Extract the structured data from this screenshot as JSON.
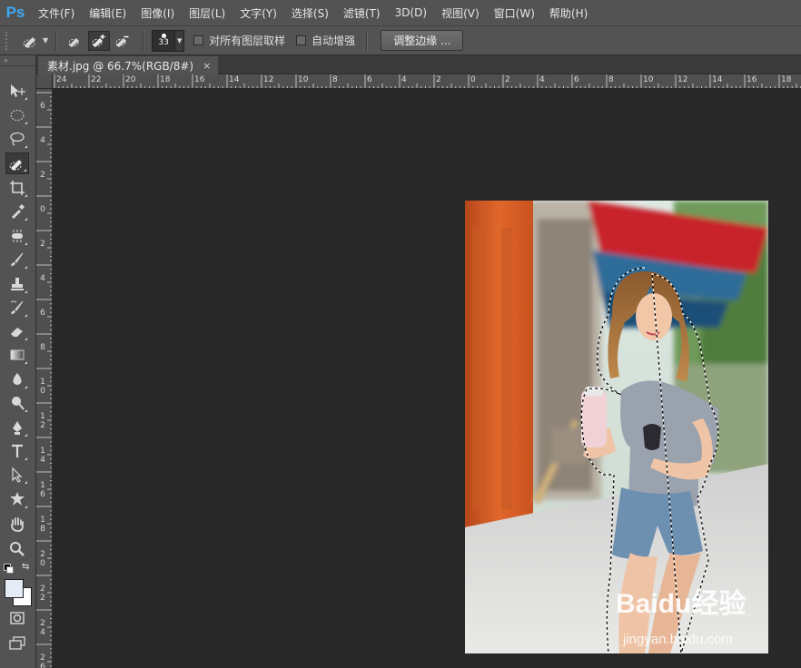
{
  "app": {
    "logo_text": "Ps",
    "accent": "#3fa9f5"
  },
  "menu": [
    "文件(F)",
    "编辑(E)",
    "图像(I)",
    "图层(L)",
    "文字(Y)",
    "选择(S)",
    "滤镜(T)",
    "3D(D)",
    "视图(V)",
    "窗口(W)",
    "帮助(H)"
  ],
  "options": {
    "brush_size": "33",
    "sample_all_layers_label": "对所有图层取样",
    "sample_all_layers_checked": false,
    "auto_enhance_label": "自动增强",
    "auto_enhance_checked": false,
    "refine_edge_label": "调整边缘 ...",
    "active_mode": "add-to-selection"
  },
  "document": {
    "tab_title": "素材.jpg @ 66.7%(RGB/8#)",
    "close_glyph": "×"
  },
  "rulers": {
    "horizontal": [
      "24",
      "22",
      "20",
      "18",
      "16",
      "14",
      "12",
      "10",
      "8",
      "6",
      "4",
      "2",
      "0",
      "2",
      "4",
      "6",
      "8",
      "10",
      "12",
      "14",
      "16",
      "18"
    ],
    "vertical": [
      "6",
      "4",
      "2",
      "0",
      "2",
      "4",
      "6",
      "8",
      "1 0",
      "1 2",
      "1 4",
      "1 6",
      "1 8",
      "2 0",
      "2 2",
      "2 4",
      "2 6"
    ]
  },
  "toolbox": {
    "active_tool": "quick-selection-tool",
    "tools": [
      "move-tool",
      "marquee-tool",
      "lasso-tool",
      "quick-selection-tool",
      "crop-tool",
      "eyedropper-tool",
      "spot-healing-tool",
      "brush-tool",
      "clone-stamp-tool",
      "history-brush-tool",
      "eraser-tool",
      "gradient-tool",
      "blur-tool",
      "dodge-tool",
      "pen-tool",
      "type-tool",
      "path-selection-tool",
      "custom-shape-tool",
      "hand-tool",
      "zoom-tool"
    ],
    "foreground_color": "#e6ecf5",
    "background_color": "#ffffff"
  },
  "watermark": {
    "main": "Baidu经验",
    "sub": "jingyan.baidu.com"
  }
}
